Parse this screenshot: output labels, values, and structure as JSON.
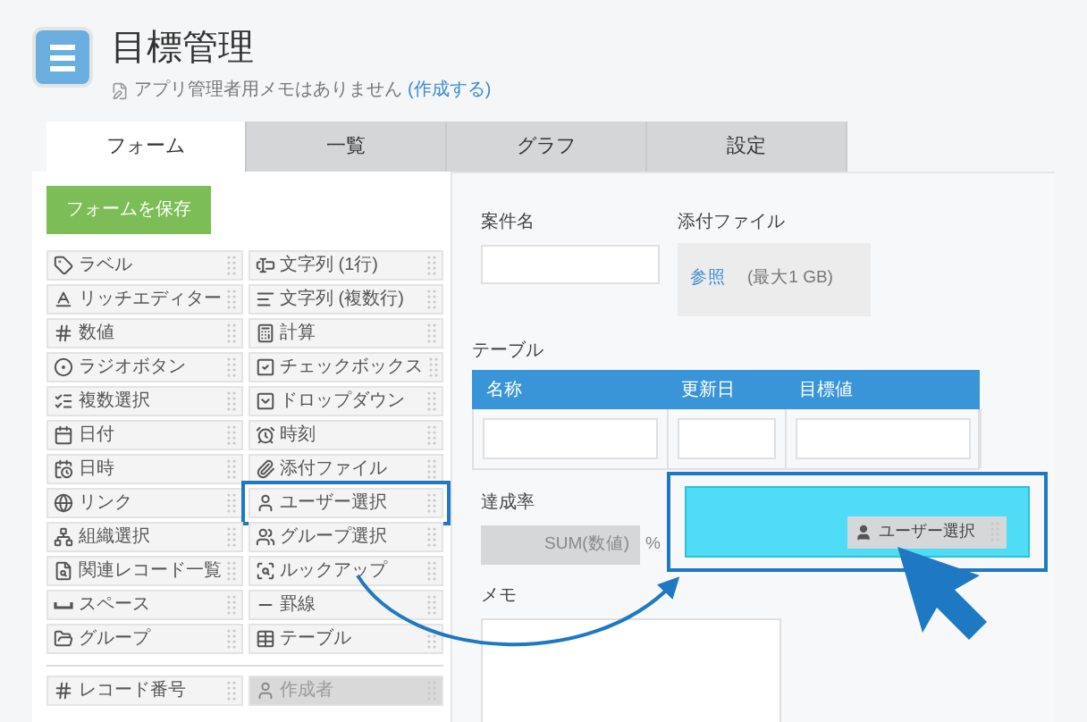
{
  "app": {
    "title": "目標管理",
    "memo_note": "アプリ管理者用メモはありません",
    "memo_link": "(作成する)"
  },
  "tabs": [
    {
      "label": "フォーム",
      "selected": true
    },
    {
      "label": "一覧",
      "selected": false
    },
    {
      "label": "グラフ",
      "selected": false
    },
    {
      "label": "設定",
      "selected": false
    }
  ],
  "save_button": "フォームを保存",
  "palette": [
    {
      "label": "ラベル",
      "highlighted": false,
      "disabled": false
    },
    {
      "label": "文字列 (1行)",
      "highlighted": false,
      "disabled": false
    },
    {
      "label": "リッチエディター",
      "highlighted": false,
      "disabled": false
    },
    {
      "label": "文字列 (複数行)",
      "highlighted": false,
      "disabled": false
    },
    {
      "label": "数値",
      "highlighted": false,
      "disabled": false
    },
    {
      "label": "計算",
      "highlighted": false,
      "disabled": false
    },
    {
      "label": "ラジオボタン",
      "highlighted": false,
      "disabled": false
    },
    {
      "label": "チェックボックス",
      "highlighted": false,
      "disabled": false
    },
    {
      "label": "複数選択",
      "highlighted": false,
      "disabled": false
    },
    {
      "label": "ドロップダウン",
      "highlighted": false,
      "disabled": false
    },
    {
      "label": "日付",
      "highlighted": false,
      "disabled": false
    },
    {
      "label": "時刻",
      "highlighted": false,
      "disabled": false
    },
    {
      "label": "日時",
      "highlighted": false,
      "disabled": false
    },
    {
      "label": "添付ファイル",
      "highlighted": false,
      "disabled": false
    },
    {
      "label": "リンク",
      "highlighted": false,
      "disabled": false
    },
    {
      "label": "ユーザー選択",
      "highlighted": true,
      "disabled": false
    },
    {
      "label": "組織選択",
      "highlighted": false,
      "disabled": false
    },
    {
      "label": "グループ選択",
      "highlighted": false,
      "disabled": false
    },
    {
      "label": "関連レコード一覧",
      "highlighted": false,
      "disabled": false
    },
    {
      "label": "ルックアップ",
      "highlighted": false,
      "disabled": false
    },
    {
      "label": "スペース",
      "highlighted": false,
      "disabled": false
    },
    {
      "label": "罫線",
      "highlighted": false,
      "disabled": false
    },
    {
      "label": "グループ",
      "highlighted": false,
      "disabled": false
    },
    {
      "label": "テーブル",
      "highlighted": false,
      "disabled": false
    }
  ],
  "system_palette": [
    {
      "label": "レコード番号",
      "highlighted": false,
      "disabled": false
    },
    {
      "label": "作成者",
      "highlighted": false,
      "disabled": true
    }
  ],
  "form": {
    "case_name": {
      "label": "案件名"
    },
    "attachment": {
      "label": "添付ファイル",
      "link": "参照",
      "limit": "(最大1 GB)"
    },
    "table": {
      "label": "テーブル",
      "columns": [
        "名称",
        "更新日",
        "目標値"
      ]
    },
    "rate": {
      "label": "達成率",
      "formula": "SUM(数値)",
      "unit": "%"
    },
    "drop_zone": {
      "chip": "ユーザー選択"
    },
    "memo": {
      "label": "メモ"
    }
  }
}
